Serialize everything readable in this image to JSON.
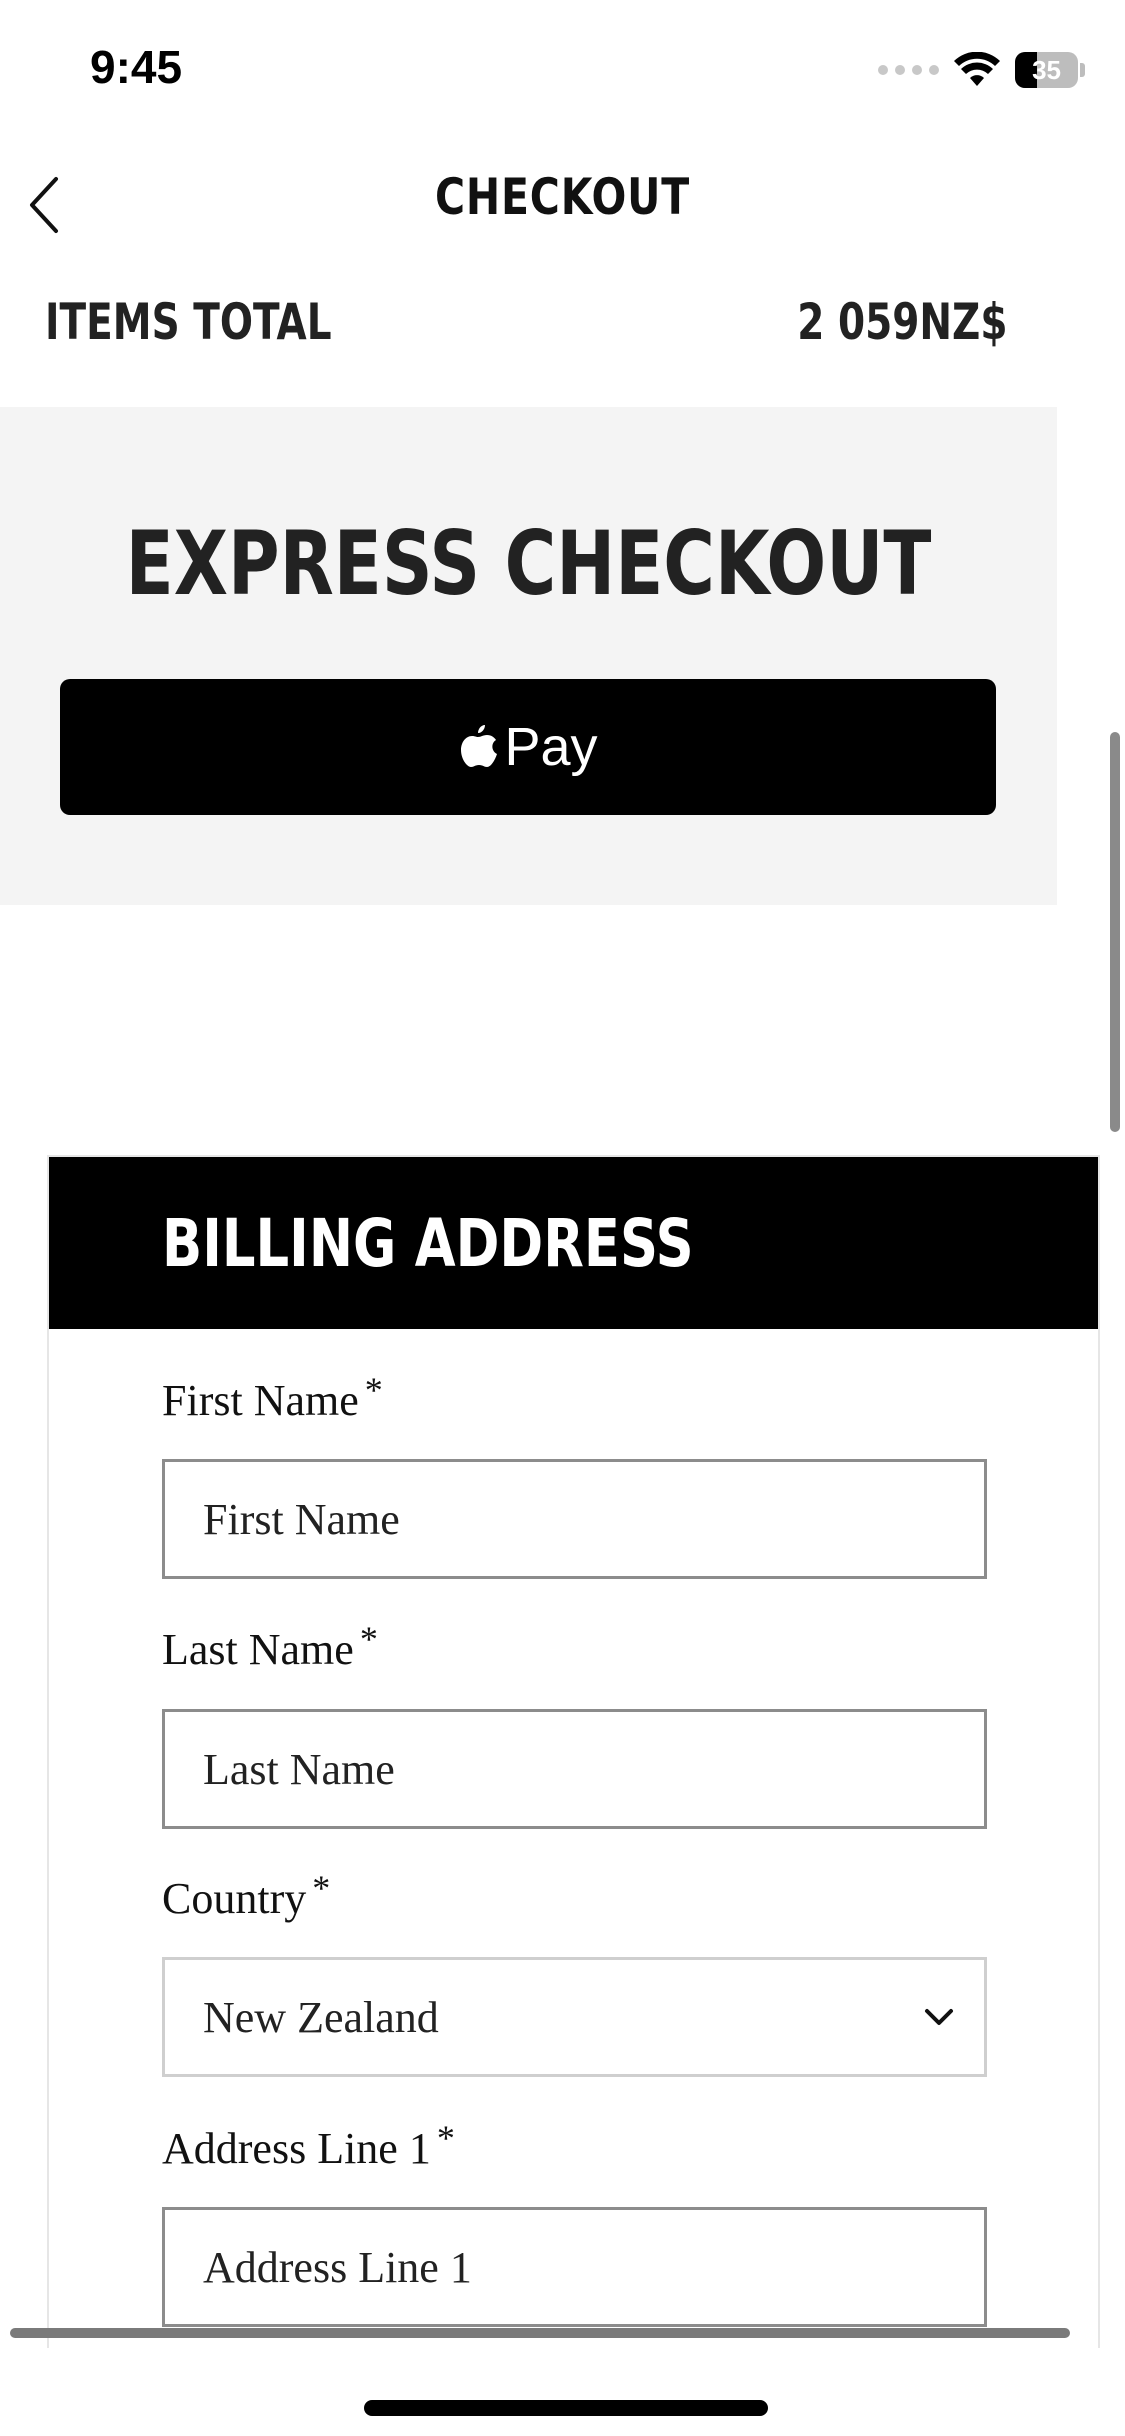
{
  "status_bar": {
    "time": "9:45",
    "battery": "35",
    "battery_level_percent": 35
  },
  "header": {
    "title": "CHECKOUT",
    "back_icon": "chevron-left-icon"
  },
  "summary": {
    "items_total_label": "ITEMS TOTAL",
    "items_total_value": "2 059NZ$"
  },
  "express": {
    "title": "EXPRESS CHECKOUT",
    "apple_pay_label": "Pay",
    "apple_pay_icon": "apple-logo-icon"
  },
  "billing": {
    "title": "BILLING ADDRESS",
    "fields": [
      {
        "label": "First Name",
        "required_mark": "*",
        "placeholder": "First Name"
      },
      {
        "label": "Last Name",
        "required_mark": "*",
        "placeholder": "Last Name"
      },
      {
        "label": "Country",
        "required_mark": "*",
        "value": "New Zealand"
      },
      {
        "label": "Address Line 1",
        "required_mark": "*",
        "placeholder": "Address Line 1"
      }
    ]
  },
  "colors": {
    "panel_background": "#f4f4f4",
    "button_black": "#000000",
    "field_border": "#8c8c8c"
  }
}
